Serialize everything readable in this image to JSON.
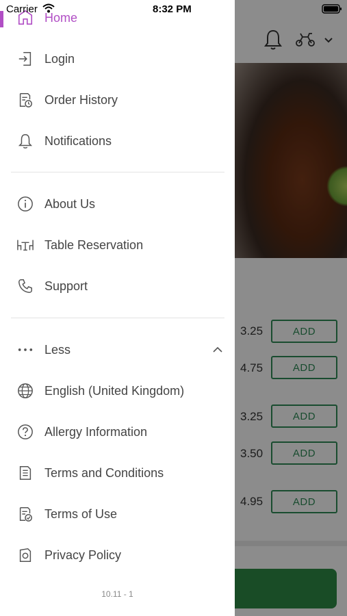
{
  "status_bar": {
    "carrier": "Carrier",
    "time": "8:32 PM"
  },
  "background": {
    "prices": [
      "3.25",
      "4.75",
      "3.25",
      "3.50",
      "4.95"
    ],
    "add_label": "ADD"
  },
  "drawer": {
    "items_top": [
      {
        "label": "Home",
        "icon": "home-icon",
        "active": true
      },
      {
        "label": "Login",
        "icon": "login-icon"
      },
      {
        "label": "Order History",
        "icon": "order-history-icon"
      },
      {
        "label": "Notifications",
        "icon": "bell-icon"
      }
    ],
    "items_middle": [
      {
        "label": "About Us",
        "icon": "info-icon"
      },
      {
        "label": "Table Reservation",
        "icon": "table-icon"
      },
      {
        "label": "Support",
        "icon": "phone-icon"
      }
    ],
    "less": {
      "label": "Less",
      "icon": "more-dots-icon"
    },
    "items_bottom": [
      {
        "label": "English (United Kingdom)",
        "icon": "globe-icon"
      },
      {
        "label": "Allergy Information",
        "icon": "question-icon"
      },
      {
        "label": "Terms and Conditions",
        "icon": "document-icon"
      },
      {
        "label": "Terms of Use",
        "icon": "document-check-icon"
      },
      {
        "label": "Privacy Policy",
        "icon": "privacy-icon"
      }
    ],
    "version": "10.11 - 1"
  },
  "colors": {
    "accent": "#b14fc5",
    "brand_green": "#2e8b57",
    "text": "#444444"
  }
}
